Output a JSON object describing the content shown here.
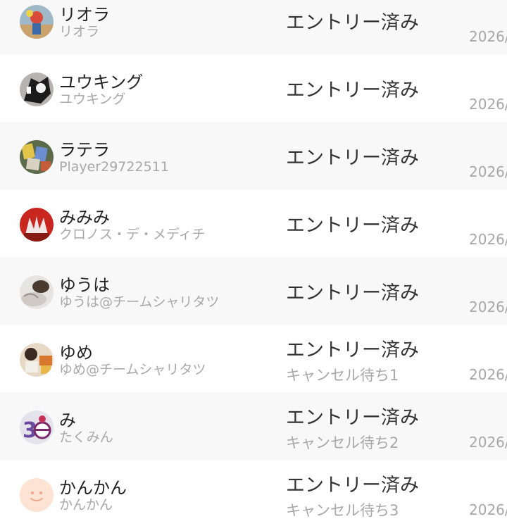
{
  "entries": [
    {
      "name": "リオラ",
      "sub": "リオラ",
      "status": "エントリー済み",
      "note": "",
      "date": "2026/"
    },
    {
      "name": "ユウキング",
      "sub": "ユウキング",
      "status": "エントリー済み",
      "note": "",
      "date": "2026/"
    },
    {
      "name": "ラテラ",
      "sub": "Player29722511",
      "status": "エントリー済み",
      "note": "",
      "date": "2026/"
    },
    {
      "name": "みみみ",
      "sub": "クロノス・デ・メディチ",
      "status": "エントリー済み",
      "note": "",
      "date": "2026/"
    },
    {
      "name": "ゆうは",
      "sub": "ゆうは@チームシャリタツ",
      "status": "エントリー済み",
      "note": "",
      "date": "2026/"
    },
    {
      "name": "ゆめ",
      "sub": "ゆめ@チームシャリタツ",
      "status": "エントリー済み",
      "note": "キャンセル待ち1",
      "date": "2026/"
    },
    {
      "name": "み",
      "sub": "たくみん",
      "status": "エントリー済み",
      "note": "キャンセル待ち2",
      "date": "2026/"
    },
    {
      "name": "かんかん",
      "sub": "かんかん",
      "status": "エントリー済み",
      "note": "キャンセル待ち3",
      "date": "2026/"
    }
  ],
  "colors": {
    "row_alt": "#f8f8f8",
    "name_text": "#222222",
    "secondary_text": "#a8a8a8",
    "status_text": "#333333"
  }
}
